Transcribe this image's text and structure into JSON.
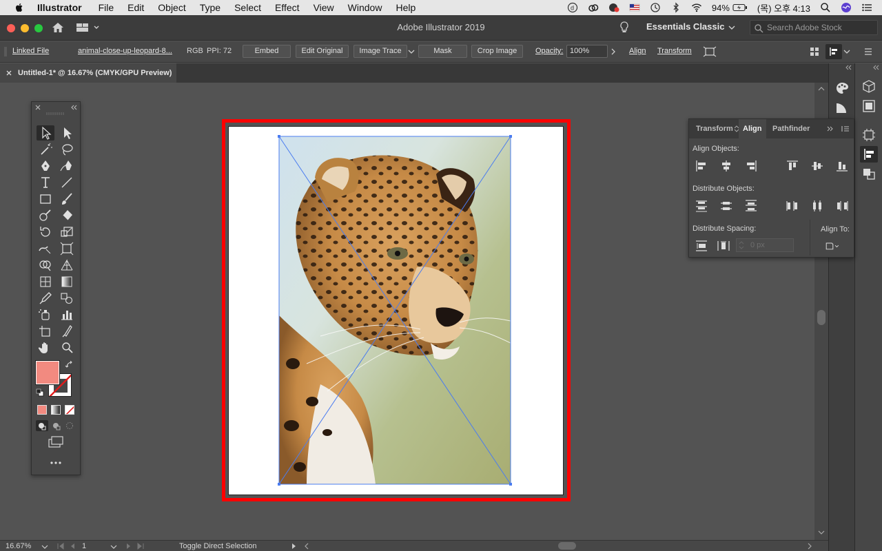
{
  "menubar": {
    "app_name": "Illustrator",
    "items": [
      "File",
      "Edit",
      "Object",
      "Type",
      "Select",
      "Effect",
      "View",
      "Window",
      "Help"
    ],
    "battery": "94%",
    "clock": "(목) 오후 4:13"
  },
  "appbar": {
    "title": "Adobe Illustrator 2019",
    "workspace": "Essentials Classic",
    "stock_placeholder": "Search Adobe Stock"
  },
  "controlbar": {
    "linked_file": "Linked File",
    "file_name": "animal-close-up-leopard-8...",
    "color_mode": "RGB",
    "ppi": "PPI: 72",
    "embed": "Embed",
    "edit_original": "Edit Original",
    "image_trace": "Image Trace",
    "mask": "Mask",
    "crop_image": "Crop Image",
    "opacity_label": "Opacity:",
    "opacity_value": "100%",
    "align": "Align",
    "transform": "Transform"
  },
  "document": {
    "tab_title": "Untitled-1* @ 16.67% (CMYK/GPU Preview)"
  },
  "statusbar": {
    "zoom": "16.67%",
    "artboard": "1",
    "status_text": "Toggle Direct Selection"
  },
  "align_panel": {
    "tabs": [
      "Transform",
      "Align",
      "Pathfinder"
    ],
    "align_objects": "Align Objects:",
    "distribute_objects": "Distribute Objects:",
    "distribute_spacing": "Distribute Spacing:",
    "align_to": "Align To:",
    "spacing_value": "0 px"
  },
  "colors": {
    "fill": "#f28a80",
    "artboard_highlight": "#ff0000",
    "selection": "#4a7cf0"
  }
}
